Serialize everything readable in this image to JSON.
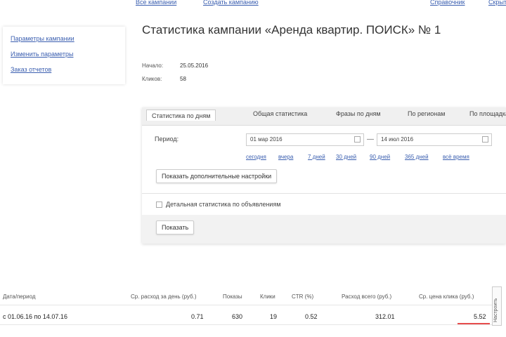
{
  "topbar": {
    "link1": "Все кампании",
    "link2": "Создать кампанию",
    "right1": "Справочник",
    "right2": "Скрыть"
  },
  "sidebar": {
    "items": [
      {
        "label": "Параметры кампании"
      },
      {
        "label": "Изменить параметры"
      },
      {
        "label": "Заказ отчетов"
      }
    ]
  },
  "page": {
    "title": "Статистика кампании «Аренда квартир. ПОИСК» № 1",
    "start_label": "Начало:",
    "start_value": "25.05.2016",
    "clicks_label": "Кликов:",
    "clicks_value": "58"
  },
  "tabs": [
    {
      "label": "Статистика по дням",
      "active": true
    },
    {
      "label": "Общая статистика"
    },
    {
      "label": "Фразы по дням"
    },
    {
      "label": "По регионам"
    },
    {
      "label": "По площадкам"
    }
  ],
  "filters": {
    "period_label": "Период:",
    "date_from": "01 мар 2016",
    "date_to": "14 июл 2016",
    "dash": "—",
    "quick_links": [
      "сегодня",
      "вчера",
      "7 дней",
      "30 дней",
      "90 дней",
      "365 дней",
      "всё время"
    ],
    "settings_button": "Показать дополнительные настройки",
    "checkbox_label": "Детальная статистика по объявлениям",
    "show_button": "Показать"
  },
  "table": {
    "headers": [
      "Дата/период",
      "Ср. расход за день (руб.)",
      "Показы",
      "Клики",
      "CTR (%)",
      "Расход всего (руб.)",
      "Ср. цена клика (руб.)"
    ],
    "row": [
      "с 01.06.16 по 14.07.16",
      "0.71",
      "630",
      "19",
      "0.52",
      "312.01",
      "5.52"
    ],
    "side_button": "Настроить"
  }
}
